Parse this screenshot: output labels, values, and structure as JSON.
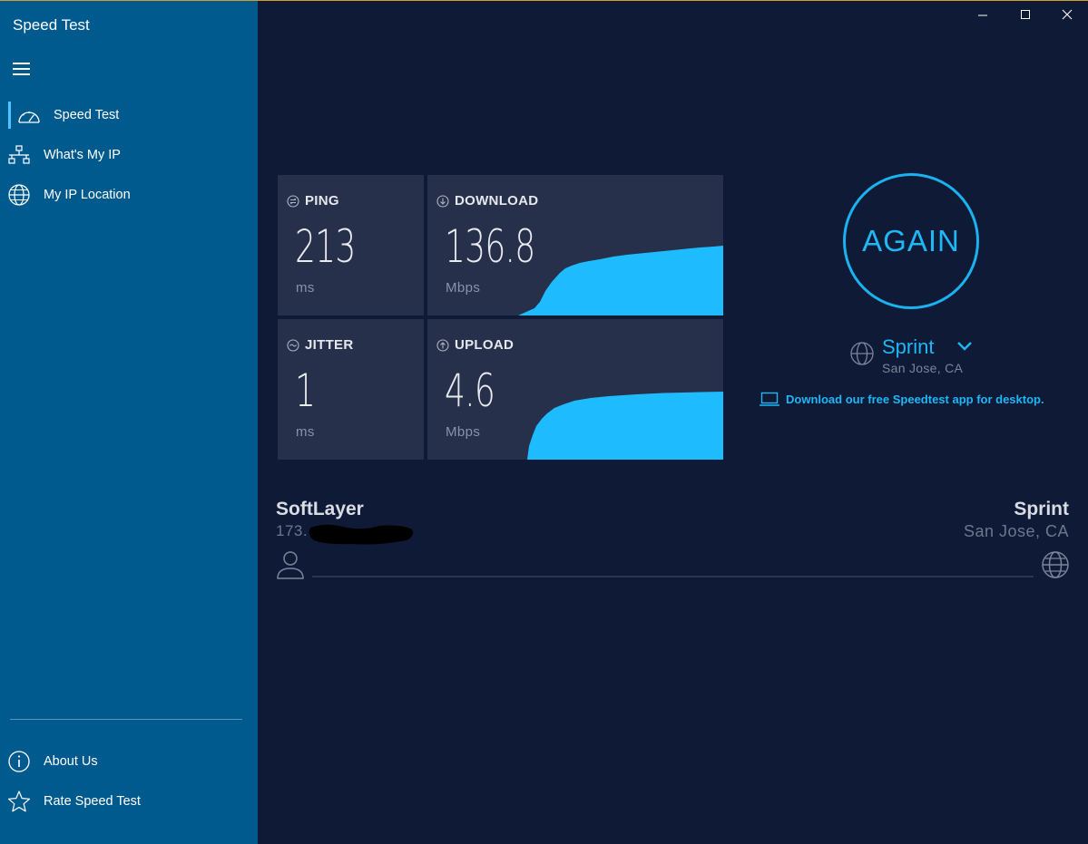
{
  "app": {
    "title": "Speed Test"
  },
  "sidebar": {
    "items": [
      {
        "label": "Speed Test",
        "icon": "speedometer-icon",
        "active": true
      },
      {
        "label": "What's My IP",
        "icon": "network-icon",
        "active": false
      },
      {
        "label": "My IP Location",
        "icon": "globe-icon",
        "active": false
      }
    ],
    "footer_items": [
      {
        "label": "About Us",
        "icon": "info-icon"
      },
      {
        "label": "Rate Speed Test",
        "icon": "star-icon"
      }
    ]
  },
  "window_controls": [
    "minimize-icon",
    "maximize-icon",
    "close-icon"
  ],
  "metrics": {
    "ping": {
      "label": "PING",
      "value": "213",
      "unit": "ms"
    },
    "jitter": {
      "label": "JITTER",
      "value": "1",
      "unit": "ms"
    },
    "download": {
      "label": "DOWNLOAD",
      "value": "136.8",
      "unit": "Mbps"
    },
    "upload": {
      "label": "UPLOAD",
      "value": "4.6",
      "unit": "Mbps"
    }
  },
  "again_button": {
    "label": "AGAIN"
  },
  "server": {
    "name": "Sprint",
    "location": "San Jose, CA"
  },
  "download_link": {
    "label": "Download our free Speedtest app for desktop."
  },
  "connection": {
    "isp_name": "SoftLayer",
    "ip_prefix": "173.",
    "server_name": "Sprint",
    "server_location": "San Jose, CA"
  },
  "colors": {
    "sidebar_bg": "#005a8e",
    "main_bg": "#0f1a36",
    "card_bg": "#26304a",
    "accent": "#1bb2f0",
    "graph_fill": "#1ebcff"
  }
}
